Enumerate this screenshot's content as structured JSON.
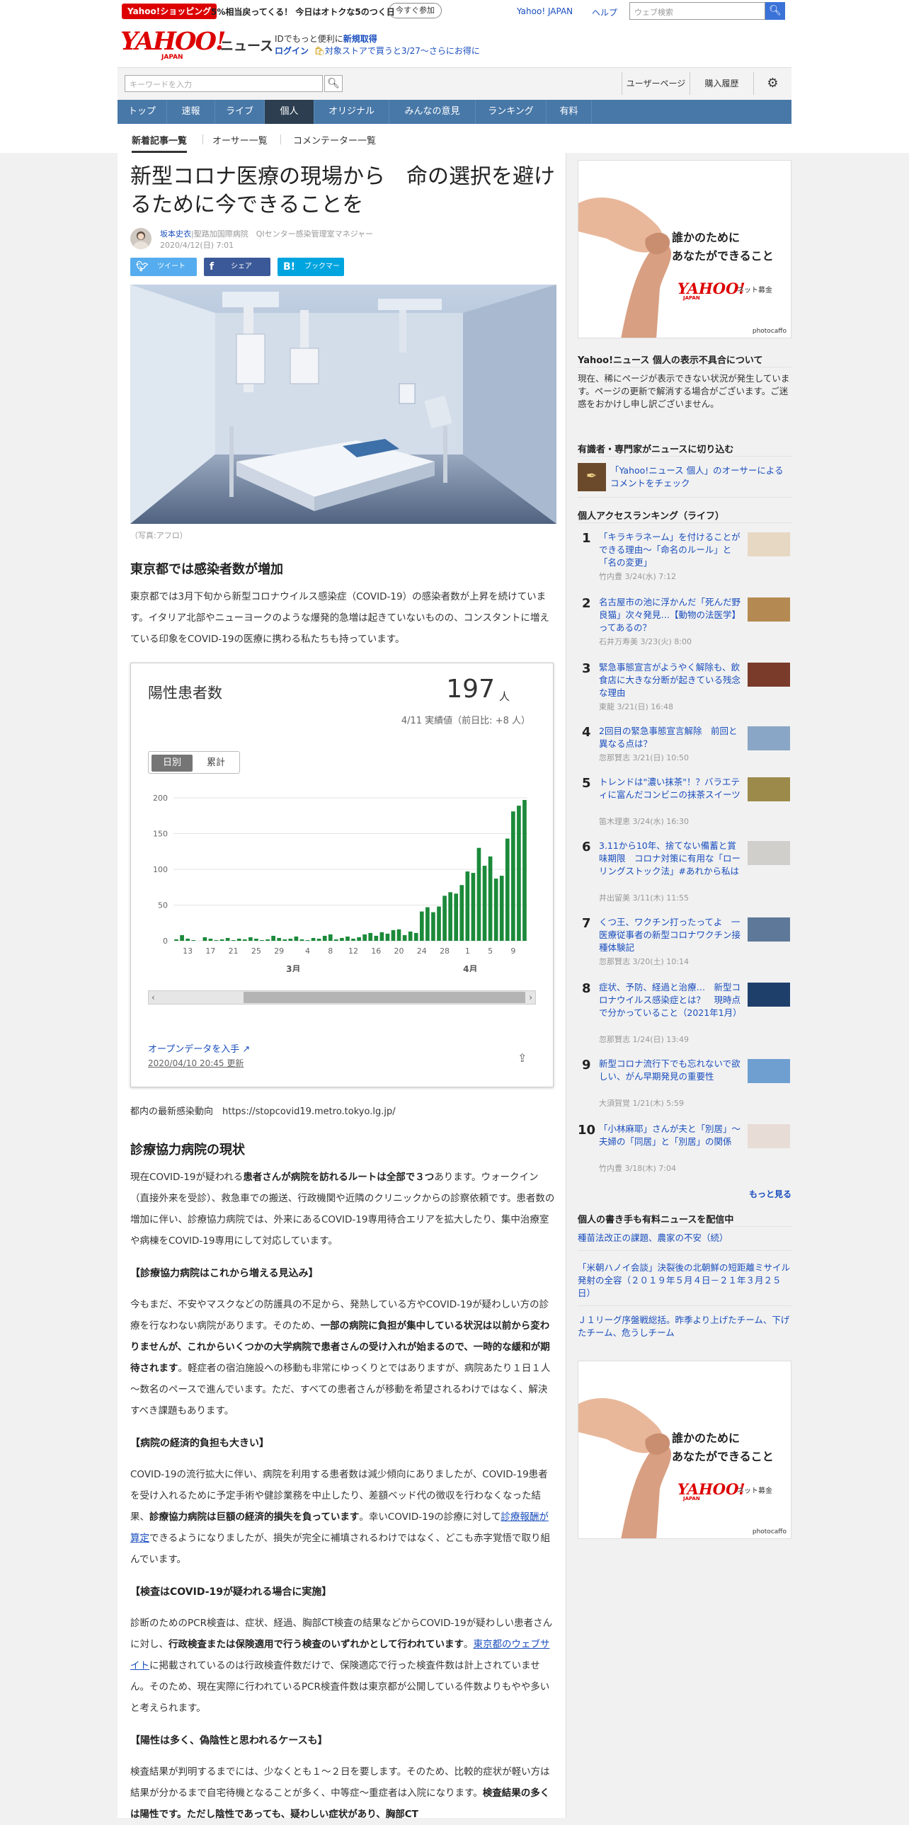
{
  "promo": {
    "tag": "Yahoo!ショッピング",
    "text": "5%相当戻ってくる！ 今日はオトクな5のつく日",
    "button": "今すぐ参加",
    "yahoo_japan": "Yahoo! JAPAN",
    "help": "ヘルプ",
    "web_search_placeholder": "ウェブ検索"
  },
  "brand": {
    "logo": "YAHOO!",
    "logo_sub": "JAPAN",
    "service": "ニュース",
    "line1_prefix": "IDでもっと便利に",
    "line1_link": "新規取得",
    "login": "ログイン",
    "line2_text": "対象ストアで買うと3/27～さらにお得に"
  },
  "search": {
    "placeholder": "キーワードを入力",
    "user_page": "ユーザーページ",
    "history": "購入履歴"
  },
  "nav": [
    "トップ",
    "速報",
    "ライブ",
    "個人",
    "オリジナル",
    "みんなの意見",
    "ランキング",
    "有料"
  ],
  "subtabs": [
    "新着記事一覧",
    "オーサー一覧",
    "コメンテーター一覧"
  ],
  "article": {
    "title": "新型コロナ医療の現場から　命の選択を避けるために今できることを",
    "author": "坂本史衣",
    "affiliation": "|聖路加国際病院　QIセンター感染管理室マネジャー",
    "date": "2020/4/12(日) 7:01",
    "share_tweet": "ツイート",
    "share_fb": "シェア",
    "share_hb": "ブックマーク",
    "photo_caption": "（写真:アフロ）",
    "h_tokyo": "東京都では感染者数が増加",
    "p_tokyo": "東京都では3月下旬から新型コロナウイルス感染症（COVID-19）の感染者数が上昇を続けています。イタリア北部やニューヨークのような爆発的急増は起きていないものの、コンスタントに増えている印象をCOVID-19の医療に携わる私たちも持っています。",
    "source_text": "都内の最新感染動向　https://stopcovid19.metro.tokyo.lg.jp/",
    "h_hosp": "診療協力病院の現状",
    "p_hosp_1": "現在COVID-19が疑われる",
    "p_hosp_b": "患者さんが病院を訪れるルートは全部で３つ",
    "p_hosp_2": "あります。ウォークイン（直接外来を受診）、救急車での搬送、行政機関や近隣のクリニックからの診察依頼です。患者数の増加に伴い、診療協力病院では、外来にあるCOVID-19専用待合エリアを拡大したり、集中治療室や病棟をCOVID-19専用にして対応しています。",
    "s1": "【診療協力病院はこれから増える見込み】",
    "p_s1_1": "今もまだ、不安やマスクなどの防護具の不足から、発熱している方やCOVID-19が疑わしい方の診療を行なわない病院があります。そのため、",
    "p_s1_b": "一部の病院に負担が集中している状況は以前から変わりませんが、これからいくつかの大学病院で患者さんの受け入れが始まるので、一時的な緩和が期待されます",
    "p_s1_2": "。軽症者の宿泊施設への移動も非常にゆっくりとではありますが、病院あたり１日１人～数名のペースで進んでいます。ただ、すべての患者さんが移動を希望されるわけではなく、解決すべき課題もあります。",
    "s2": "【病院の経済的負担も大きい】",
    "p_s2_1": "COVID-19の流行拡大に伴い、病院を利用する患者数は減少傾向にありましたが、COVID-19患者を受け入れるために予定手術や健診業務を中止したり、差額ベッド代の徴収を行わなくなった結果、",
    "p_s2_b": "診療協力病院は巨額の経済的損失を負っています",
    "p_s2_2": "。幸いCOVID-19の診療に対して",
    "p_s2_link": "診療報酬が算定",
    "p_s2_3": "できるようになりましたが、損失が完全に補填されるわけではなく、どこも赤字覚悟で取り組んでいます。",
    "s3": "【検査はCOVID-19が疑われる場合に実施】",
    "p_s3_1": "診断のためのPCR検査は、症状、経過、胸部CT検査の結果などからCOVID-19が疑わしい患者さんに対し、",
    "p_s3_b": "行政検査または保険適用で行う検査のいずれかとして行われています",
    "p_s3_2": "。",
    "p_s3_link": "東京都のウェブサイト",
    "p_s3_3": "に掲載されているのは行政検査件数だけで、保険適応で行った検査件数は計上されていません。そのため、現在実際に行われているPCR検査件数は東京都が公開している件数よりもやや多いと考えられます。",
    "s4": "【陽性は多く、偽陰性と思われるケースも】",
    "p_s4_1": "検査結果が判明するまでには、少なくとも１～２日を要します。そのため、比較的症状が軽い方は結果が分かるまで自宅待機となることが多く、中等症～重症者は入院になります。",
    "p_s4_b": "検査結果の多くは陽性です。ただし陰性であっても、疑わしい症状があり、胸部CT"
  },
  "card": {
    "title": "陽性患者数",
    "value": "197",
    "unit": "人",
    "sub": "4/11 実績値（前日比: +8 人）",
    "toggle_daily": "日別",
    "toggle_cumulative": "累計",
    "open_data": "オープンデータを入手",
    "updated": "2020/04/10 20:45 更新"
  },
  "chart_data": {
    "type": "bar",
    "title": "陽性患者数",
    "ylim": [
      0,
      200
    ],
    "yticks": [
      0,
      50,
      100,
      150,
      200
    ],
    "color": "#1b8a3a",
    "xtick_labels": [
      "13",
      "17",
      "21",
      "25",
      "29",
      "4",
      "8",
      "12",
      "16",
      "20",
      "24",
      "28",
      "1",
      "5",
      "9"
    ],
    "month_labels": [
      "3月",
      "4月"
    ],
    "values": [
      2,
      8,
      3,
      1,
      0,
      5,
      3,
      1,
      2,
      4,
      1,
      3,
      2,
      5,
      3,
      1,
      2,
      7,
      4,
      2,
      3,
      6,
      2,
      1,
      4,
      3,
      7,
      9,
      2,
      4,
      6,
      3,
      5,
      9,
      11,
      7,
      12,
      10,
      15,
      16,
      8,
      13,
      11,
      41,
      47,
      40,
      48,
      63,
      68,
      66,
      78,
      97,
      95,
      130,
      105,
      118,
      87,
      91,
      143,
      181,
      189,
      197
    ]
  },
  "sidebar": {
    "ad_text1": "誰かのために",
    "ad_text2": "あなたができること",
    "ad_brand": "YAHOO!",
    "ad_brand_sub": "ネット募金",
    "ad_brand_jp": "JAPAN",
    "ad_credit": "photocaffo",
    "notice_title": "Yahoo!ニュース 個人の表示不具合について",
    "notice_body": "現在、稀にページが表示できない状況が発生しています。ページの更新で解消する場合がございます。ご迷惑をおかけし申し訳ございません。",
    "experts_title": "有識者・専門家がニュースに切り込む",
    "experts_link": "「Yahoo!ニュース 個人」のオーサーによるコメントをチェック",
    "ranking_title": "個人アクセスランキング（ライフ）",
    "ranking": [
      {
        "n": "1",
        "title": "「キラキラネーム」を付けることができる理由～「命名のルール」と「名の変更」",
        "meta": "竹内豊 3/24(水) 7:12"
      },
      {
        "n": "2",
        "title": "名古屋市の池に浮かんだ「死んだ野良猫」次々発見…【動物の法医学】ってあるの？",
        "meta": "石井万寿美 3/23(火) 8:00"
      },
      {
        "n": "3",
        "title": "緊急事態宣言がようやく解除も、飲食店に大きな分断が起きている残念な理由",
        "meta": "東龍 3/21(日) 16:48"
      },
      {
        "n": "4",
        "title": "2回目の緊急事態宣言解除　前回と異なる点は？",
        "meta": "忽那賢志 3/21(日) 10:50"
      },
      {
        "n": "5",
        "title": "トレンドは\"濃い抹茶\"！？バラエティに富んだコンビニの抹茶スイーツ",
        "meta": "笛木理恵 3/24(水) 16:30"
      },
      {
        "n": "6",
        "title": "3.11から10年、捨てない備蓄と賞味期限　コロナ対策に有用な「ローリングストック法」#あれから私は",
        "meta": "井出留美 3/11(木) 11:55"
      },
      {
        "n": "7",
        "title": "くつ王、ワクチン打ったってよ　一医療従事者の新型コロナワクチン接種体験記",
        "meta": "忽那賢志 3/20(土) 10:14"
      },
      {
        "n": "8",
        "title": "症状、予防、経過と治療…　新型コロナウイルス感染症とは？　現時点で分かっていること（2021年1月）",
        "meta": "忽那賢志 1/24(日) 13:49"
      },
      {
        "n": "9",
        "title": "新型コロナ流行下でも忘れないで欲しい、がん早期発見の重要性",
        "meta": "大須賀覚 1/21(木) 5:59"
      },
      {
        "n": "10",
        "title": "「小林麻耶」さんが夫と「別居」～夫婦の「同居」と「別居」の関係",
        "meta": "竹内豊 3/18(木) 7:04"
      }
    ],
    "more": "もっと見る",
    "paid_title": "個人の書き手も有料ニュースを配信中",
    "paid_links": [
      "種苗法改正の課題、農家の不安（続）",
      "「米朝ハノイ会談」決裂後の北朝鮮の短距離ミサイル発射の全容（２０１９年５月４日－２１年３月２５日）",
      "Ｊ１リーグ序盤戦総括。昨季より上げたチーム、下げたチーム、危うしチーム"
    ]
  }
}
